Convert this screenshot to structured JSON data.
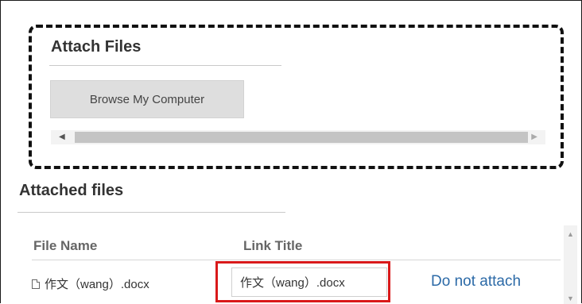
{
  "attach": {
    "title": "Attach Files",
    "browse_label": "Browse My Computer"
  },
  "attached": {
    "title": "Attached files",
    "columns": {
      "file_name": "File Name",
      "link_title": "Link Title"
    },
    "rows": [
      {
        "file_name": "作文（wang）.docx",
        "link_title": "作文（wang）.docx",
        "action": "Do not attach"
      }
    ]
  },
  "icons": {
    "file": "document-icon",
    "scroll_left": "arrow-left-icon",
    "scroll_right": "arrow-right-icon",
    "scroll_up": "arrow-up-icon",
    "scroll_down": "arrow-down-icon"
  },
  "colors": {
    "link": "#2c6aa7",
    "highlight": "#d9191a",
    "button_bg": "#dedede"
  }
}
